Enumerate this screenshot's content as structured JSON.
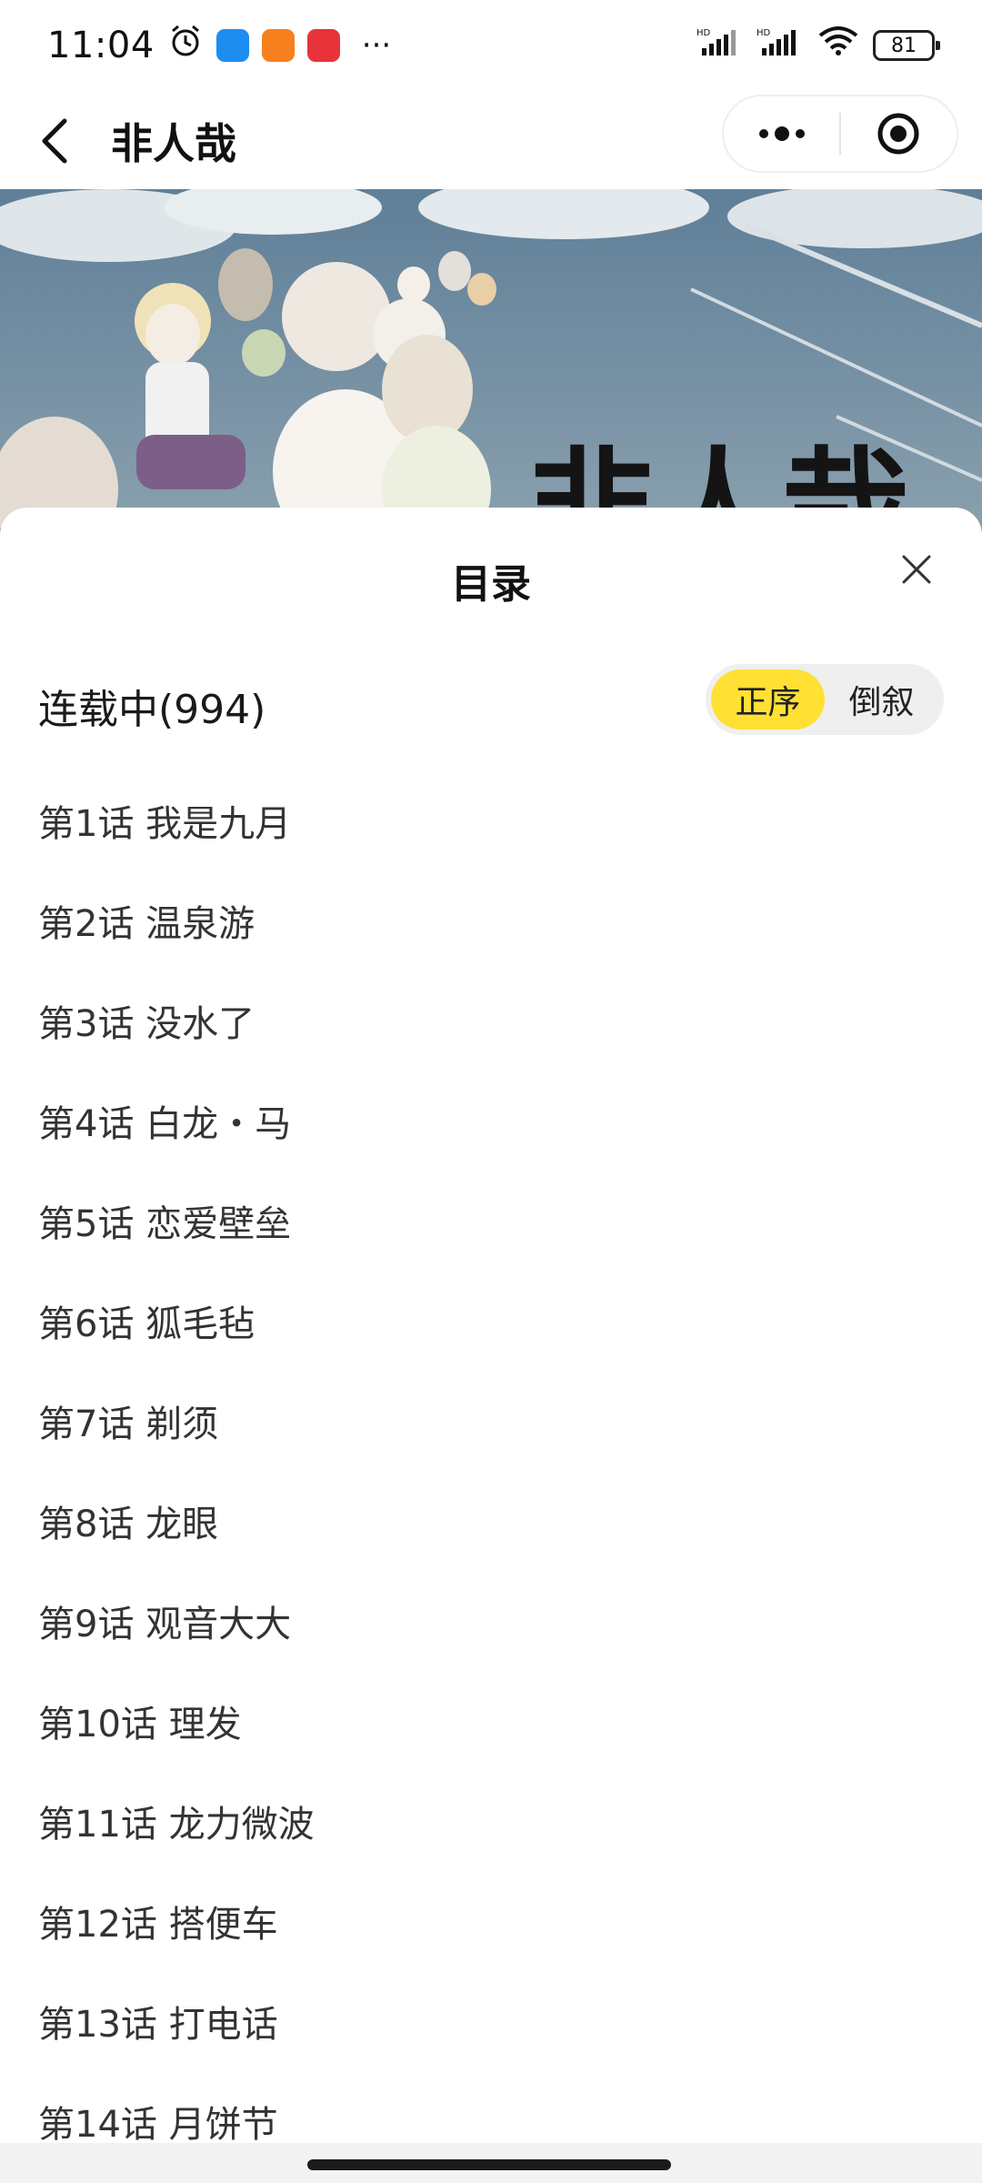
{
  "status_bar": {
    "time": "11:04",
    "more": "···",
    "battery": "81",
    "app_icons": [
      {
        "name": "blue-app-icon",
        "color": "#1f8cf0"
      },
      {
        "name": "orange-app-icon",
        "color": "#f7801f"
      },
      {
        "name": "red-app-icon",
        "color": "#e8333a"
      }
    ]
  },
  "header": {
    "title": "非人哉"
  },
  "sheet": {
    "title": "目录",
    "status": "连载中(994)",
    "order_asc": "正序",
    "order_desc": "倒叙",
    "toggle_active_color": "#ffe033"
  },
  "chapters": [
    "第1话 我是九月",
    "第2话 温泉游",
    "第3话 没水了",
    "第4话 白龙・马",
    "第5话 恋爱壁垒",
    "第6话 狐毛毡",
    "第7话 剃须",
    "第8话 龙眼",
    "第9话 观音大大",
    "第10话 理发",
    "第11话 龙力微波",
    "第12话 搭便车",
    "第13话 打电话",
    "第14话 月饼节"
  ]
}
